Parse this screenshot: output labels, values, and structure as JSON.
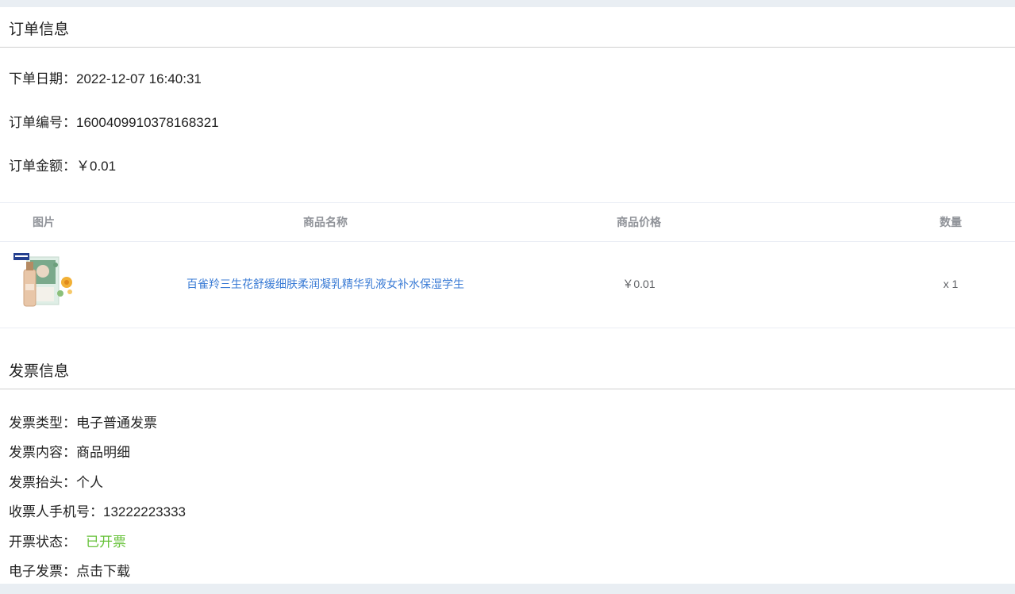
{
  "order_section": {
    "title": "订单信息",
    "date_label": "下单日期：",
    "date_value": "2022-12-07 16:40:31",
    "number_label": "订单编号：",
    "number_value": "1600409910378168321",
    "amount_label": "订单金额：",
    "amount_value": "￥0.01"
  },
  "products_table": {
    "headers": [
      "图片",
      "商品名称",
      "商品价格",
      "数量"
    ],
    "rows": [
      {
        "image_alt": "product-thumbnail",
        "name": "百雀羚三生花舒缓细肤柔润凝乳精华乳液女补水保湿学生",
        "price": "￥0.01",
        "quantity": "x 1"
      }
    ]
  },
  "invoice_section": {
    "title": "发票信息",
    "type_label": "发票类型：",
    "type_value": "电子普通发票",
    "content_label": "发票内容：",
    "content_value": "商品明细",
    "header_label": "发票抬头：",
    "header_value": "个人",
    "phone_label": "收票人手机号：",
    "phone_value": "13222223333",
    "status_label": "开票状态：",
    "status_value": "已开票",
    "download_label": "电子发票：",
    "download_value": "点击下载"
  },
  "colors": {
    "page_background": "#e9eef3",
    "status_green": "#67c23a",
    "link_blue": "#3a7bd5",
    "header_gray": "#909399"
  }
}
